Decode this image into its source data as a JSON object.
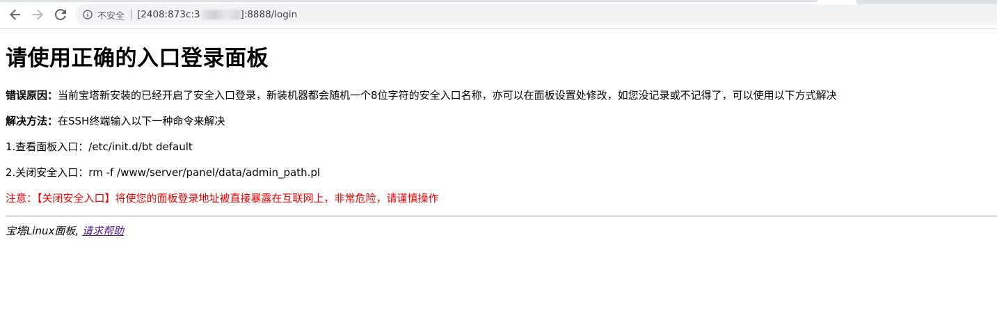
{
  "browser": {
    "security_label": "不安全",
    "url_prefix": "[2408:873c:3",
    "url_suffix": "]:8888/login"
  },
  "page": {
    "title": "请使用正确的入口登录面板",
    "reason": {
      "label": "错误原因：",
      "text": "当前宝塔新安装的已经开启了安全入口登录，新装机器都会随机一个8位字符的安全入口名称，亦可以在面板设置处修改，如您没记录或不记得了，可以使用以下方式解决"
    },
    "method": {
      "label": "解决方法：",
      "text": "在SSH终端输入以下一种命令来解决"
    },
    "steps": [
      "1.查看面板入口：/etc/init.d/bt default",
      "2.关闭安全入口：rm -f /www/server/panel/data/admin_path.pl"
    ],
    "warning": "注意：【关闭安全入口】将使您的面板登录地址被直接暴露在互联网上，非常危险，请谨慎操作",
    "footer": {
      "brand": "宝塔Linux面板,",
      "help_link": "请求帮助"
    }
  },
  "colors": {
    "warning": "#ee0000",
    "visited_link": "#551a8b"
  }
}
